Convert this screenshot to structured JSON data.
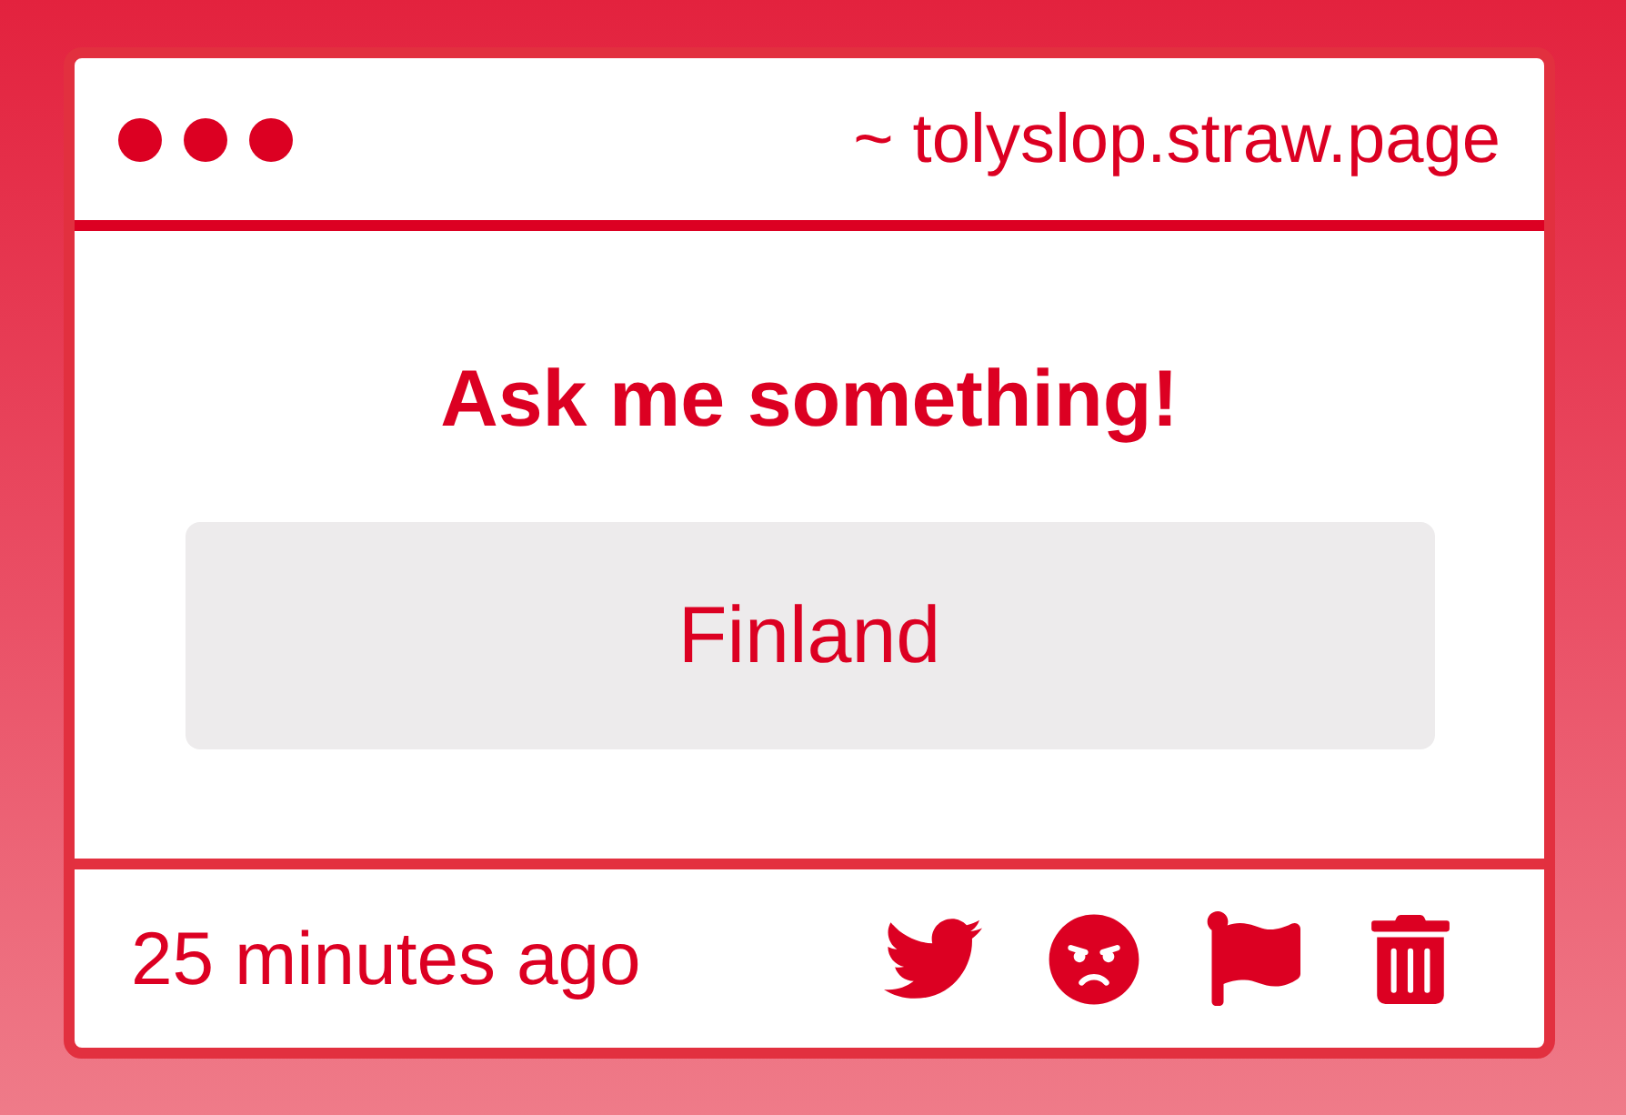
{
  "window": {
    "address": "~ tolyslop.straw.page"
  },
  "question": {
    "title": "Ask me something!",
    "answer": "Finland"
  },
  "footer": {
    "time": "25 minutes ago"
  }
}
